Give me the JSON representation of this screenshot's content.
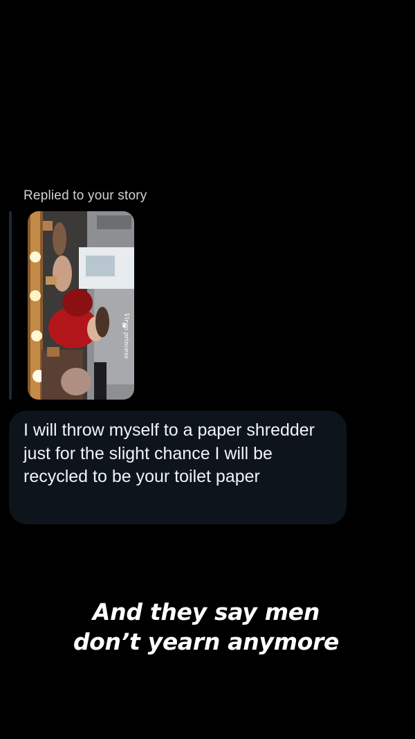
{
  "reply": {
    "label": "Replied to your story",
    "story_caption": "Virgo princess"
  },
  "message": {
    "text": "I will throw myself to a paper shredder just for the slight chance I will be recycled to be your toilet paper"
  },
  "overlay_caption": {
    "line1": "And they say men",
    "line2": "don’t yearn anymore"
  },
  "colors": {
    "background": "#000000",
    "bubble": "#0d141c",
    "reply_bar": "#1c2a3a",
    "caption_text": "#ffffff"
  }
}
